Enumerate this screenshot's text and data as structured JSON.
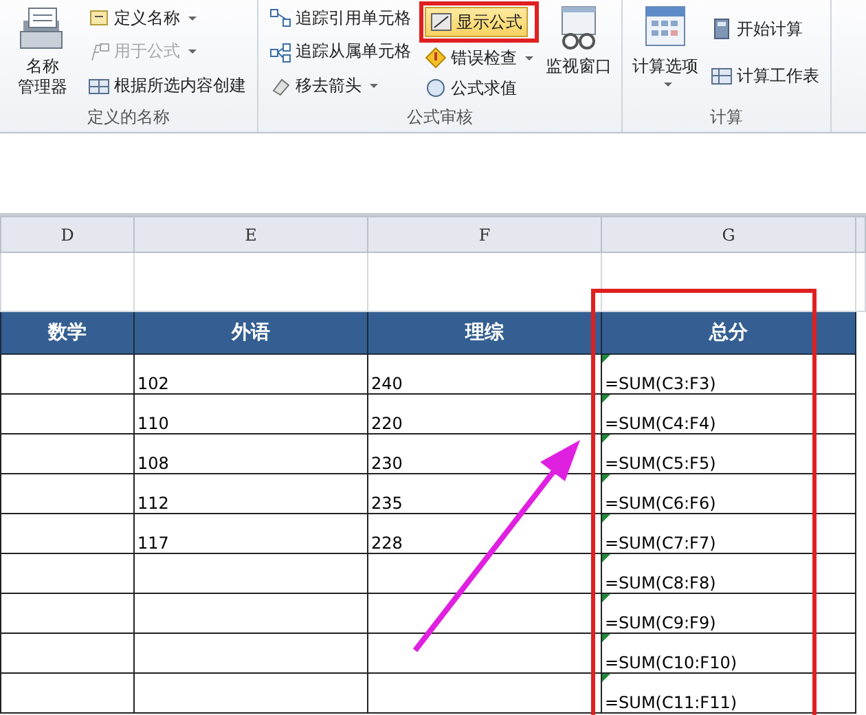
{
  "ribbon": {
    "groups": [
      {
        "label": "定义的名称",
        "large": [
          {
            "lines": [
              "名称",
              "管理器"
            ],
            "has_menu": false
          }
        ],
        "small_columns": [
          [
            {
              "label": "定义名称",
              "has_menu": true,
              "disabled": false,
              "selected": false
            },
            {
              "label": "用于公式",
              "has_menu": true,
              "disabled": true,
              "selected": false
            },
            {
              "label": "根据所选内容创建",
              "has_menu": false,
              "disabled": false,
              "selected": false
            }
          ]
        ]
      },
      {
        "label": "公式审核",
        "small_columns": [
          [
            {
              "label": "追踪引用单元格",
              "has_menu": false,
              "disabled": false,
              "selected": false
            },
            {
              "label": "追踪从属单元格",
              "has_menu": false,
              "disabled": false,
              "selected": false
            },
            {
              "label": "移去箭头",
              "has_menu": true,
              "disabled": false,
              "selected": false
            }
          ],
          [
            {
              "label": "显示公式",
              "has_menu": false,
              "disabled": false,
              "selected": true
            },
            {
              "label": "错误检查",
              "has_menu": true,
              "disabled": false,
              "selected": false
            },
            {
              "label": "公式求值",
              "has_menu": false,
              "disabled": false,
              "selected": false
            }
          ]
        ],
        "large_after": [
          {
            "lines": [
              "监视窗口"
            ],
            "has_menu": false
          }
        ]
      },
      {
        "label": "计算",
        "large": [
          {
            "lines": [
              "计算选项"
            ],
            "has_menu": true
          }
        ],
        "small_columns": [
          [
            {
              "label": "开始计算",
              "has_menu": false,
              "disabled": false,
              "selected": false
            },
            {
              "label": "计算工作表",
              "has_menu": false,
              "disabled": false,
              "selected": false
            }
          ]
        ]
      }
    ]
  },
  "sheet": {
    "columns": [
      "D",
      "E",
      "F",
      "G"
    ],
    "header": [
      "数学",
      "外语",
      "理综",
      "总分"
    ],
    "rows": [
      {
        "cells": [
          "",
          "102",
          "240",
          "=SUM(C3:F3)"
        ],
        "flagged": true
      },
      {
        "cells": [
          "",
          "110",
          "220",
          "=SUM(C4:F4)"
        ],
        "flagged": true
      },
      {
        "cells": [
          "",
          "108",
          "230",
          "=SUM(C5:F5)"
        ],
        "flagged": true
      },
      {
        "cells": [
          "",
          "112",
          "235",
          "=SUM(C6:F6)"
        ],
        "flagged": true
      },
      {
        "cells": [
          "",
          "117",
          "228",
          "=SUM(C7:F7)"
        ],
        "flagged": true
      },
      {
        "cells": [
          "",
          "",
          "",
          "=SUM(C8:F8)"
        ],
        "flagged": true
      },
      {
        "cells": [
          "",
          "",
          "",
          "=SUM(C9:F9)"
        ],
        "flagged": true
      },
      {
        "cells": [
          "",
          "",
          "",
          "=SUM(C10:F10)"
        ],
        "flagged": true
      },
      {
        "cells": [
          "",
          "",
          "",
          "=SUM(C11:F11)"
        ],
        "flagged": true
      }
    ]
  },
  "annotations": [
    {
      "kind": "button-frame"
    },
    {
      "kind": "column-frame"
    },
    {
      "kind": "arrow"
    }
  ]
}
